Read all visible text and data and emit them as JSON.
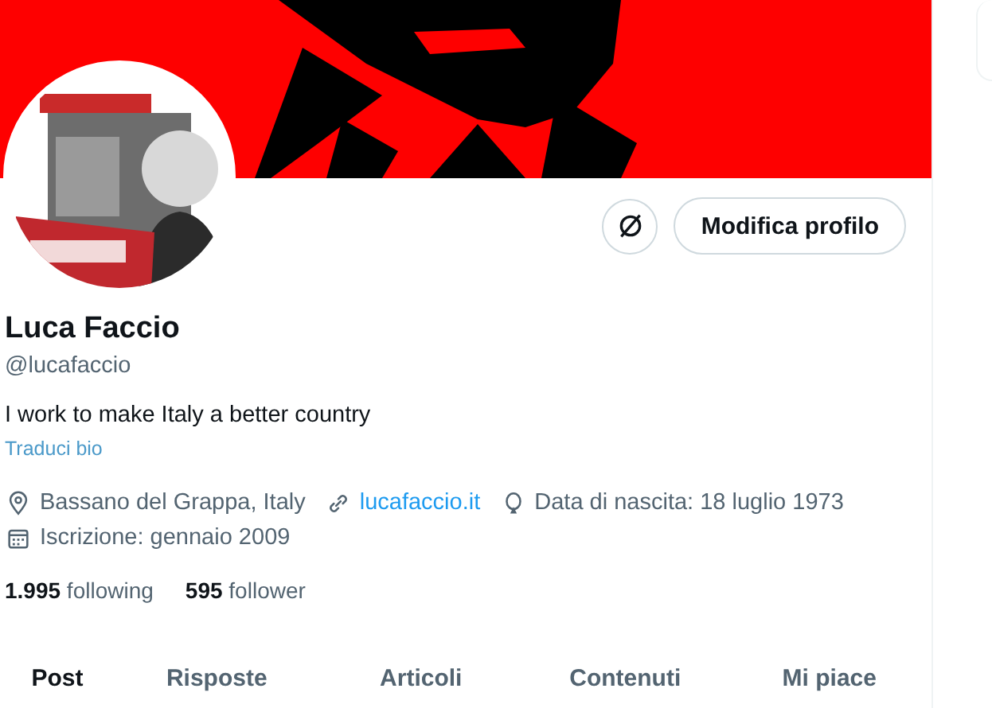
{
  "profile": {
    "name": "Luca Faccio",
    "handle": "@lucafaccio",
    "bio": "I work to make Italy a better country",
    "translate_link": "Traduci bio",
    "details": [
      {
        "kind": "location",
        "text": "Bassano del Grappa, Italy"
      },
      {
        "kind": "link",
        "text": "lucafaccio.it"
      },
      {
        "kind": "birthday",
        "text": "Data di nascita: 18 luglio 1973"
      },
      {
        "kind": "joined",
        "text": "Iscrizione: gennaio 2009"
      }
    ],
    "stats": [
      "**1.995** following",
      "**595** follower"
    ]
  },
  "edit_button": "Modifica profilo",
  "tabs": [
    {
      "label": "Post",
      "selected": true
    },
    {
      "label": "Risposte",
      "selected": false
    },
    {
      "label": "Articoli",
      "selected": false
    },
    {
      "label": "Contenuti",
      "selected": false
    },
    {
      "label": "Mi piace",
      "selected": false
    }
  ]
}
